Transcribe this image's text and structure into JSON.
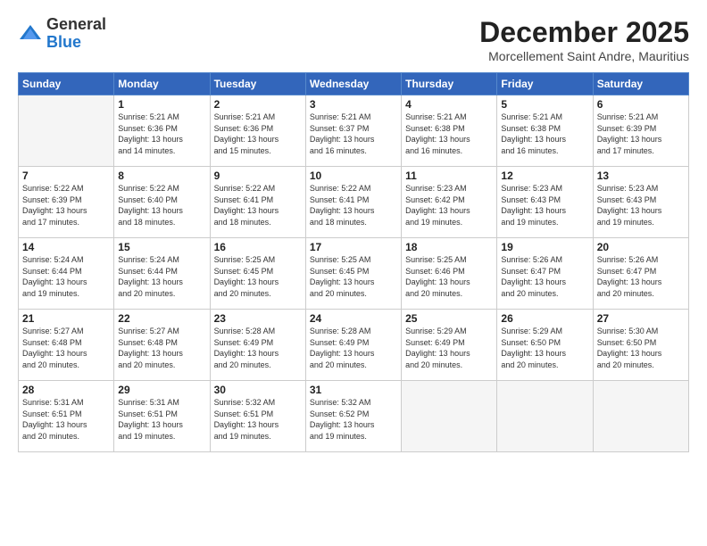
{
  "logo": {
    "general": "General",
    "blue": "Blue"
  },
  "header": {
    "month": "December 2025",
    "location": "Morcellement Saint Andre, Mauritius"
  },
  "days_of_week": [
    "Sunday",
    "Monday",
    "Tuesday",
    "Wednesday",
    "Thursday",
    "Friday",
    "Saturday"
  ],
  "weeks": [
    [
      {
        "day": "",
        "info": ""
      },
      {
        "day": "1",
        "info": "Sunrise: 5:21 AM\nSunset: 6:36 PM\nDaylight: 13 hours\nand 14 minutes."
      },
      {
        "day": "2",
        "info": "Sunrise: 5:21 AM\nSunset: 6:36 PM\nDaylight: 13 hours\nand 15 minutes."
      },
      {
        "day": "3",
        "info": "Sunrise: 5:21 AM\nSunset: 6:37 PM\nDaylight: 13 hours\nand 16 minutes."
      },
      {
        "day": "4",
        "info": "Sunrise: 5:21 AM\nSunset: 6:38 PM\nDaylight: 13 hours\nand 16 minutes."
      },
      {
        "day": "5",
        "info": "Sunrise: 5:21 AM\nSunset: 6:38 PM\nDaylight: 13 hours\nand 16 minutes."
      },
      {
        "day": "6",
        "info": "Sunrise: 5:21 AM\nSunset: 6:39 PM\nDaylight: 13 hours\nand 17 minutes."
      }
    ],
    [
      {
        "day": "7",
        "info": "Sunrise: 5:22 AM\nSunset: 6:39 PM\nDaylight: 13 hours\nand 17 minutes."
      },
      {
        "day": "8",
        "info": "Sunrise: 5:22 AM\nSunset: 6:40 PM\nDaylight: 13 hours\nand 18 minutes."
      },
      {
        "day": "9",
        "info": "Sunrise: 5:22 AM\nSunset: 6:41 PM\nDaylight: 13 hours\nand 18 minutes."
      },
      {
        "day": "10",
        "info": "Sunrise: 5:22 AM\nSunset: 6:41 PM\nDaylight: 13 hours\nand 18 minutes."
      },
      {
        "day": "11",
        "info": "Sunrise: 5:23 AM\nSunset: 6:42 PM\nDaylight: 13 hours\nand 19 minutes."
      },
      {
        "day": "12",
        "info": "Sunrise: 5:23 AM\nSunset: 6:43 PM\nDaylight: 13 hours\nand 19 minutes."
      },
      {
        "day": "13",
        "info": "Sunrise: 5:23 AM\nSunset: 6:43 PM\nDaylight: 13 hours\nand 19 minutes."
      }
    ],
    [
      {
        "day": "14",
        "info": "Sunrise: 5:24 AM\nSunset: 6:44 PM\nDaylight: 13 hours\nand 19 minutes."
      },
      {
        "day": "15",
        "info": "Sunrise: 5:24 AM\nSunset: 6:44 PM\nDaylight: 13 hours\nand 20 minutes."
      },
      {
        "day": "16",
        "info": "Sunrise: 5:25 AM\nSunset: 6:45 PM\nDaylight: 13 hours\nand 20 minutes."
      },
      {
        "day": "17",
        "info": "Sunrise: 5:25 AM\nSunset: 6:45 PM\nDaylight: 13 hours\nand 20 minutes."
      },
      {
        "day": "18",
        "info": "Sunrise: 5:25 AM\nSunset: 6:46 PM\nDaylight: 13 hours\nand 20 minutes."
      },
      {
        "day": "19",
        "info": "Sunrise: 5:26 AM\nSunset: 6:47 PM\nDaylight: 13 hours\nand 20 minutes."
      },
      {
        "day": "20",
        "info": "Sunrise: 5:26 AM\nSunset: 6:47 PM\nDaylight: 13 hours\nand 20 minutes."
      }
    ],
    [
      {
        "day": "21",
        "info": "Sunrise: 5:27 AM\nSunset: 6:48 PM\nDaylight: 13 hours\nand 20 minutes."
      },
      {
        "day": "22",
        "info": "Sunrise: 5:27 AM\nSunset: 6:48 PM\nDaylight: 13 hours\nand 20 minutes."
      },
      {
        "day": "23",
        "info": "Sunrise: 5:28 AM\nSunset: 6:49 PM\nDaylight: 13 hours\nand 20 minutes."
      },
      {
        "day": "24",
        "info": "Sunrise: 5:28 AM\nSunset: 6:49 PM\nDaylight: 13 hours\nand 20 minutes."
      },
      {
        "day": "25",
        "info": "Sunrise: 5:29 AM\nSunset: 6:49 PM\nDaylight: 13 hours\nand 20 minutes."
      },
      {
        "day": "26",
        "info": "Sunrise: 5:29 AM\nSunset: 6:50 PM\nDaylight: 13 hours\nand 20 minutes."
      },
      {
        "day": "27",
        "info": "Sunrise: 5:30 AM\nSunset: 6:50 PM\nDaylight: 13 hours\nand 20 minutes."
      }
    ],
    [
      {
        "day": "28",
        "info": "Sunrise: 5:31 AM\nSunset: 6:51 PM\nDaylight: 13 hours\nand 20 minutes."
      },
      {
        "day": "29",
        "info": "Sunrise: 5:31 AM\nSunset: 6:51 PM\nDaylight: 13 hours\nand 19 minutes."
      },
      {
        "day": "30",
        "info": "Sunrise: 5:32 AM\nSunset: 6:51 PM\nDaylight: 13 hours\nand 19 minutes."
      },
      {
        "day": "31",
        "info": "Sunrise: 5:32 AM\nSunset: 6:52 PM\nDaylight: 13 hours\nand 19 minutes."
      },
      {
        "day": "",
        "info": ""
      },
      {
        "day": "",
        "info": ""
      },
      {
        "day": "",
        "info": ""
      }
    ]
  ]
}
